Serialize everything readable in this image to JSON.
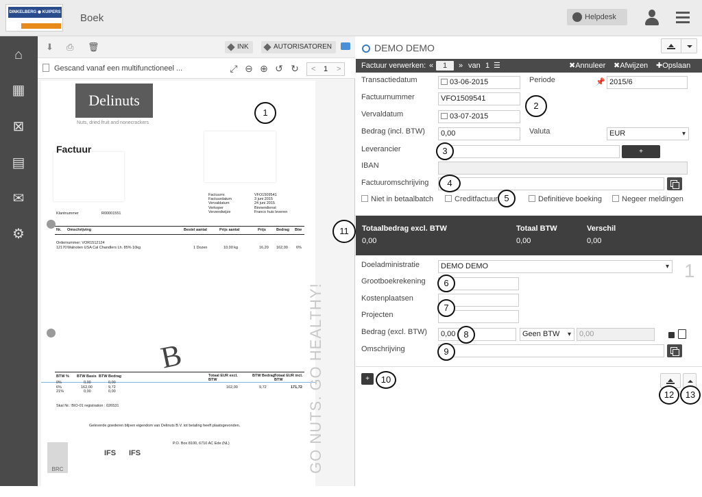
{
  "header": {
    "logo_line1": "DINKELBERG ◉ KUIPERS",
    "logo_line2": "",
    "title": "Boek",
    "helpdesk": "Helpdesk"
  },
  "toolbar": {
    "ink": "INK",
    "autorisatoren": "AUTORISATOREN"
  },
  "document": {
    "name": "Gescand vanaf een multifunctioneel ...",
    "page": "1",
    "prev": "<",
    "next": ">"
  },
  "invoice": {
    "brand": "Delinuts",
    "tagline": "Nuts, dried fruit and nonecrackers",
    "heading": "Factuur",
    "meta_labels": [
      "Factuurnr.",
      "Factuurdatum",
      "Vervaldatum",
      "Verkoper",
      "Verzendwijze"
    ],
    "meta_values": [
      "VFO1509541",
      "3 juni 2015",
      "24 juni 2015",
      "Binnendienst",
      "Franco huis leveren"
    ],
    "klantnummer_label": "Klantnummer",
    "klantnummer": "R00001551",
    "cols": [
      "Nr.",
      "Omschrijving",
      "Bestel aantal",
      "Prijs aantal",
      "Prijs",
      "Bedrag",
      "Btw"
    ],
    "row": [
      "12170",
      "Walnoten USA Cal Chandlers Lh. 85% 10kg",
      "1 Dozen",
      "10,00 kg",
      "16,20",
      "162,00",
      "6%"
    ],
    "ordernr": "Ordernummer: VOR1512124",
    "btw_head": [
      "BTW %",
      "BTW Basis",
      "BTW Bedrag"
    ],
    "btw_rows": [
      [
        "0%",
        "0,00",
        "0,00"
      ],
      [
        "6%",
        "162,00",
        "9,72"
      ],
      [
        "21%",
        "0,00",
        "0,00"
      ]
    ],
    "tot_head": [
      "Totaal EUR excl. BTW",
      "BTW Bedrag",
      "Totaal EUR incl. BTW"
    ],
    "tot_vals": [
      "162,00",
      "9,72",
      "171,72"
    ],
    "skal": "Skal Nr.: BIO-01 registration : 026531",
    "footer": "Geleverde goederen blijven eigendom van Delinuts B.V. tot betaling heeft plaatsgevonden.",
    "postal": "P.O. Box 8100, 6710 AC Ede (NL)",
    "handwritten": "B",
    "vertical": "GO NUTS. GO HEALTHY!",
    "logos": [
      "BRC",
      "IFS",
      "IFS"
    ]
  },
  "right": {
    "title": "DEMO DEMO",
    "bar": {
      "label": "Factuur verwerken:",
      "first": "«",
      "page": "1",
      "next": "»",
      "van": "van",
      "total": "1",
      "annuleer": "Annuleer",
      "afwijzen": "Afwijzen",
      "opslaan": "Opslaan"
    },
    "form": {
      "transactiedatum_label": "Transactiedatum",
      "transactiedatum": "03-06-2015",
      "periode_label": "Periode",
      "periode": "2015/6",
      "factuurnummer_label": "Factuurnummer",
      "factuurnummer": "VFO1509541",
      "vervaldatum_label": "Vervaldatum",
      "vervaldatum": "03-07-2015",
      "bedrag_label": "Bedrag (incl. BTW)",
      "bedrag": "0,00",
      "valuta_label": "Valuta",
      "valuta": "EUR",
      "leverancier_label": "Leverancier",
      "leverancier_add": "+",
      "iban_label": "IBAN",
      "omschrijving_label": "Factuuromschrijving",
      "checks": [
        "Niet in betaalbatch",
        "Creditfactuur",
        "Definitieve boeking",
        "Negeer meldingen"
      ]
    },
    "totals": {
      "excl_label": "Totaalbedrag excl. BTW",
      "excl": "0,00",
      "btw_label": "Totaal BTW",
      "btw": "0,00",
      "verschil_label": "Verschil",
      "verschil": "0,00"
    },
    "line": {
      "doel_label": "Doeladministratie",
      "doel": "DEMO DEMO",
      "line_no": "1",
      "grootboek_label": "Grootboekrekening",
      "kosten_label": "Kostenplaatsen",
      "projecten_label": "Projecten",
      "bedrag_label": "Bedrag (excl. BTW)",
      "bedrag": "0,00",
      "btw_code": "Geen BTW",
      "btw_amount": "0,00",
      "omschrijving_label": "Omschrijving",
      "add": "+"
    }
  },
  "callouts": [
    "1",
    "2",
    "3",
    "4",
    "5",
    "6",
    "7",
    "8",
    "9",
    "10",
    "11",
    "12",
    "13"
  ]
}
